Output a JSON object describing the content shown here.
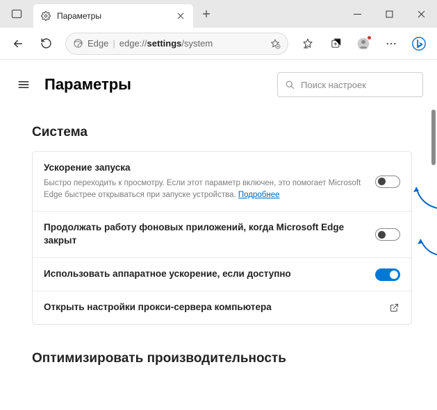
{
  "tab": {
    "title": "Параметры"
  },
  "address": {
    "label": "Edge",
    "url_prefix": "edge://",
    "url_bold": "settings",
    "url_suffix": "/system"
  },
  "page": {
    "title": "Параметры",
    "search_placeholder": "Поиск настроек"
  },
  "section1": {
    "title": "Система",
    "rows": [
      {
        "title": "Ускорение запуска",
        "desc_pre": "Быстро переходить к просмотру. Если этот параметр включен, это помогает Microsoft Edge быстрее открываться при запуске устройства. ",
        "learn_more": "Подробнее",
        "toggle": "off"
      },
      {
        "title": "Продолжать работу фоновых приложений, когда Microsoft Edge закрыт",
        "toggle": "off"
      },
      {
        "title": "Использовать аппаратное ускорение, если доступно",
        "toggle": "on"
      },
      {
        "title": "Открыть настройки прокси-сервера компьютера",
        "external": true
      }
    ]
  },
  "section2": {
    "title": "Оптимизировать производительность"
  }
}
